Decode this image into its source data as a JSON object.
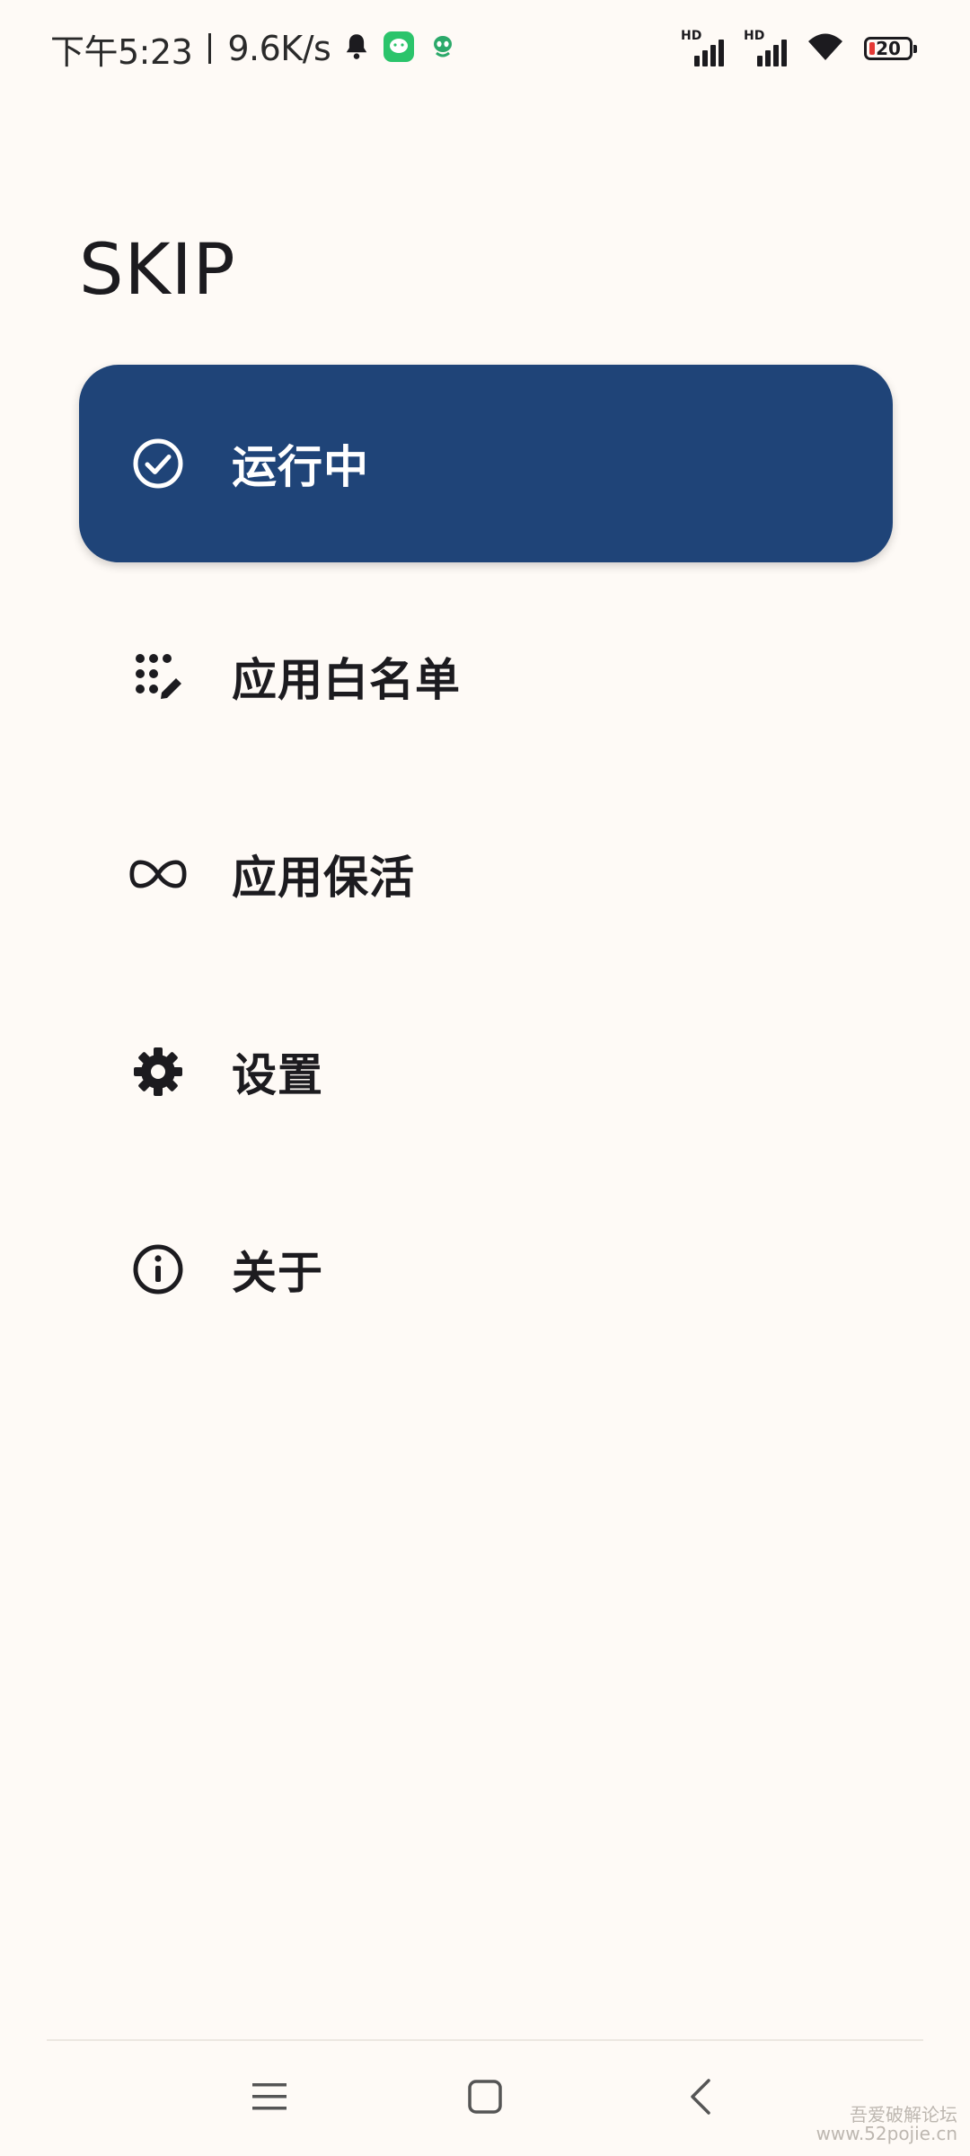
{
  "status_bar": {
    "time": "下午5:23",
    "network_speed": "9.6K/s",
    "signal_1_tag": "HD",
    "signal_2_tag": "HD",
    "battery_level": "20"
  },
  "app": {
    "title": "SKIP"
  },
  "nav": {
    "items": [
      {
        "label": "运行中",
        "icon": "check-circle-icon",
        "active": true
      },
      {
        "label": "应用白名单",
        "icon": "apps-edit-icon",
        "active": false
      },
      {
        "label": "应用保活",
        "icon": "infinity-icon",
        "active": false
      },
      {
        "label": "设置",
        "icon": "gear-icon",
        "active": false
      },
      {
        "label": "关于",
        "icon": "info-icon",
        "active": false
      }
    ]
  },
  "colors": {
    "background": "#FEFAF6",
    "active_item": "#1F4478",
    "active_text": "#FFFFFF",
    "text": "#1C1B1F",
    "battery_low": "#E53935",
    "chat_icon": "#2BC46B"
  },
  "system_nav": {
    "buttons": [
      "menu-icon",
      "home-icon",
      "back-icon"
    ]
  },
  "watermark": {
    "line1": "吾爱破解论坛",
    "line2": "www.52pojie.cn"
  }
}
